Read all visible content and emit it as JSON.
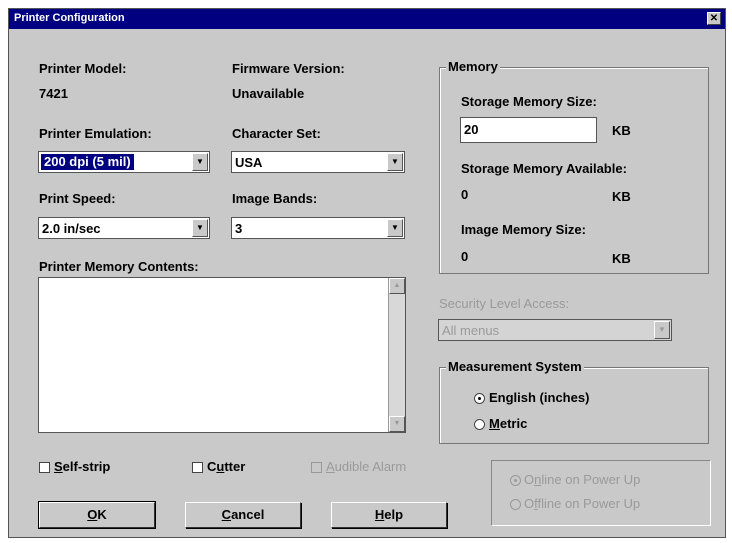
{
  "window": {
    "title": "Printer Configuration",
    "close_glyph": "✕"
  },
  "printer_model": {
    "label": "Printer Model:",
    "value": "7421"
  },
  "firmware": {
    "label": "Firmware Version:",
    "value": "Unavailable"
  },
  "emulation": {
    "label": "Printer Emulation:",
    "value": "200 dpi (5 mil)"
  },
  "charset": {
    "label": "Character Set:",
    "value": "USA"
  },
  "print_speed": {
    "label": "Print Speed:",
    "value": "2.0 in/sec"
  },
  "image_bands": {
    "label": "Image Bands:",
    "value": "3"
  },
  "memory_contents": {
    "label": "Printer Memory Contents:"
  },
  "memory": {
    "legend": "Memory",
    "storage_size_label": "Storage Memory Size:",
    "storage_size_value": "20",
    "storage_size_unit": "KB",
    "storage_avail_label": "Storage Memory Available:",
    "storage_avail_value": "0",
    "storage_avail_unit": "KB",
    "image_size_label": "Image Memory Size:",
    "image_size_value": "0",
    "image_size_unit": "KB"
  },
  "security": {
    "label": "Security Level Access:",
    "value": "All menus"
  },
  "measurement": {
    "legend": "Measurement System",
    "english": "English (inches)",
    "metric_prefix": "",
    "metric_u": "M",
    "metric_rest": "etric"
  },
  "checks": {
    "selfstrip_u": "S",
    "selfstrip_rest": "elf-strip",
    "cutter_a": "C",
    "cutter_u": "u",
    "cutter_rest": "tter",
    "alarm_u": "A",
    "alarm_rest": "udible Alarm"
  },
  "power": {
    "online": "Online on Power Up",
    "offline_a": "O",
    "offline_u": "f",
    "offline_rest": "fline on Power Up",
    "online_a": "O",
    "online_u": "n",
    "online_rest": "line on Power Up"
  },
  "buttons": {
    "ok_u": "O",
    "ok_rest": "K",
    "cancel_u": "C",
    "cancel_rest": "ancel",
    "help_u": "H",
    "help_rest": "elp"
  },
  "icons": {
    "dropdown": "▼",
    "scroll_up": "▲",
    "scroll_down": "▼"
  }
}
